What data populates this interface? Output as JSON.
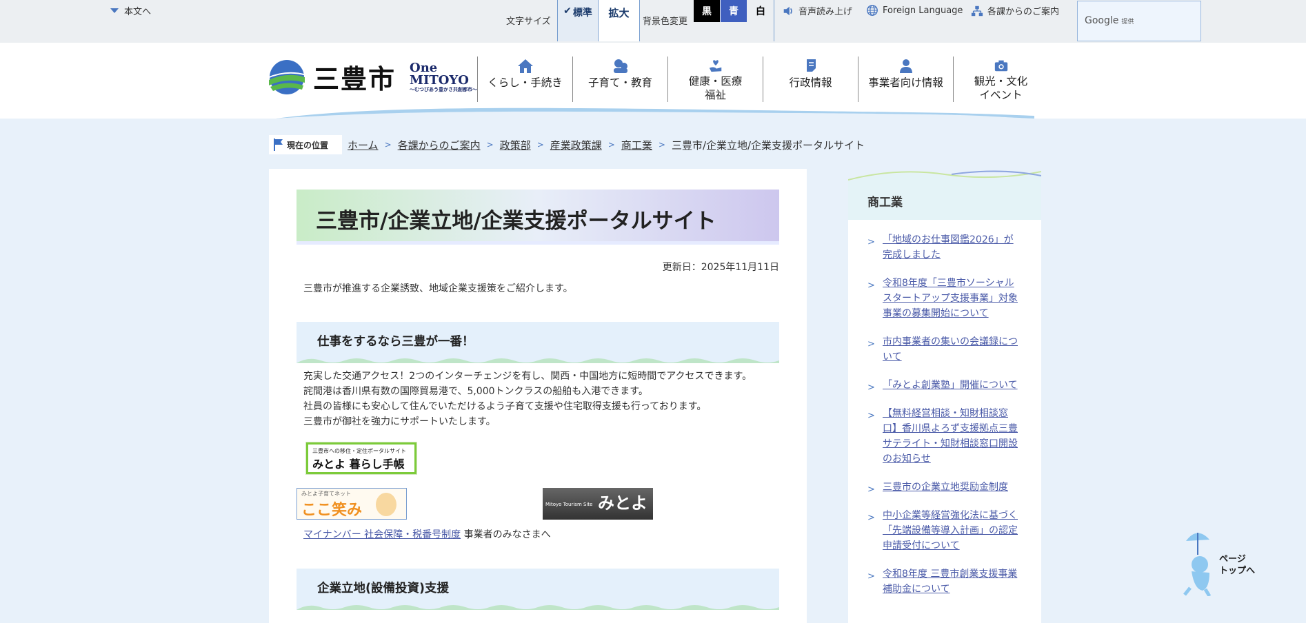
{
  "topbar": {
    "skip_link": "本文へ",
    "font_size_label": "文字サイズ",
    "font_standard": "標準",
    "font_large": "拡大",
    "bg_color_label": "背景色変更",
    "bg_black": "黒",
    "bg_blue": "青",
    "bg_white": "白",
    "read_aloud": "音声読み上げ",
    "foreign_language": "Foreign Language",
    "department_guide": "各課からのご案内",
    "google_label": "Google",
    "google_provided": "提供"
  },
  "header": {
    "logo_text": "三豊市",
    "logo_one": "One",
    "logo_mitoyo": "MITOYO",
    "logo_tagline": "〜むつびあう豊かさ共創都市〜",
    "nav": [
      {
        "label": "くらし・手続き",
        "icon": "house-icon"
      },
      {
        "label": "子育て・教育",
        "icon": "children-icon"
      },
      {
        "label": "健康・医療 福祉",
        "icon": "heart-hand-icon"
      },
      {
        "label": "行政情報",
        "icon": "flag-document-icon"
      },
      {
        "label": "事業者向け情報",
        "icon": "business-person-icon"
      },
      {
        "label": "観光・文化 イベント",
        "icon": "camera-icon"
      }
    ]
  },
  "breadcrumb": {
    "here_label": "現在の位置",
    "items": [
      "ホーム",
      "各課からのご案内",
      "政策部",
      "産業政策課",
      "商工業"
    ],
    "current": "三豊市/企業立地/企業支援ポータルサイト"
  },
  "main": {
    "title": "三豊市/企業立地/企業支援ポータルサイト",
    "updated": "更新日：2025年11月11日",
    "intro": "三豊市が推進する企業誘致、地域企業支援策をご紹介します。",
    "section1_title": "仕事をするなら三豊が一番！",
    "section1_lines": [
      "充実した交通アクセス！2つのインターチェンジを有し、関西・中国地方に短時間でアクセスできます。",
      "詫間港は香川県有数の国際貿易港で、5,000トンクラスの船舶も入港できます。",
      "社員の皆様にも安心して住んでいただけるよう子育て支援や住宅取得支援も行っております。",
      "三豊市が御社を強力にサポートいたします。"
    ],
    "banner_kurashi_small": "三豊市への移住・定住ポータルサイト",
    "banner_kurashi_big": "みとよ 暮らし手帳",
    "banner_kokoemi_small": "みとよ子育てネット",
    "banner_kokoemi_big": "ここ笑み",
    "banner_mitoyo_big": "みとよ",
    "banner_mitoyo_small": "Mitoyo Tourism Site",
    "link_mynumber": "マイナンバー 社会保障・税番号制度",
    "link_mynumber_suffix": " 事業者のみなさまへ",
    "section2_title": "企業立地(設備投資)支援"
  },
  "sidebar": {
    "title": "商工業",
    "items": [
      "「地域のお仕事図鑑2026」が完成しました",
      "令和8年度「三豊市ソーシャルスタートアップ支援事業」対象事業の募集開始について",
      "市内事業者の集いの会議録について",
      "「みとよ創業塾」開催について",
      "【無料経営相談・知財相談窓口】香川県よろず支援拠点三豊サテライト・知財相談窓口開設のお知らせ",
      "三豊市の企業立地奨励金制度",
      "中小企業等経営強化法に基づく「先端設備等導入計画」の認定申請受付について",
      "令和8年度 三豊市創業支援事業補助金について"
    ]
  },
  "pagetop": {
    "label_line1": "ページ",
    "label_line2": "トップへ"
  }
}
